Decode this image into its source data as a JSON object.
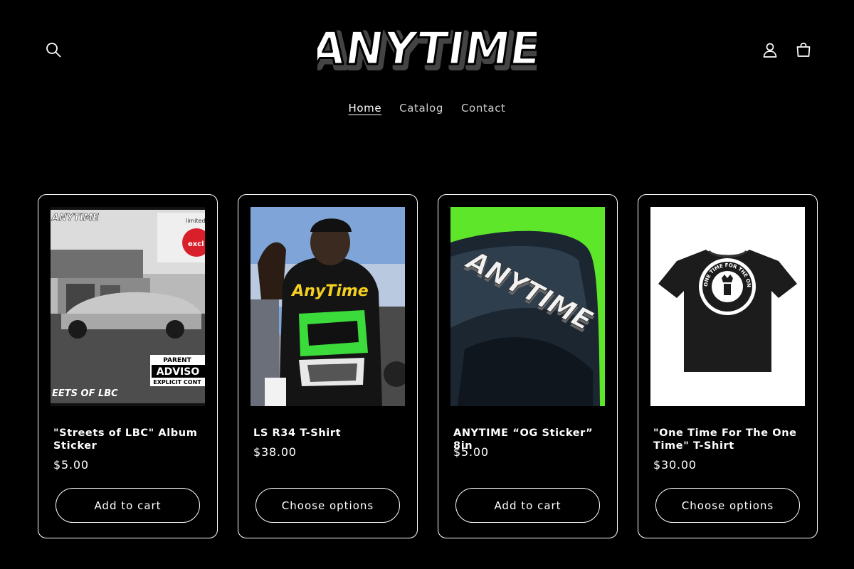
{
  "header": {
    "logo_text": "ANYTIME",
    "search_icon": "search-icon",
    "account_icon": "account-icon",
    "cart_icon": "cart-icon"
  },
  "nav": {
    "items": [
      {
        "label": "Home",
        "active": true
      },
      {
        "label": "Catalog",
        "active": false
      },
      {
        "label": "Contact",
        "active": false
      }
    ]
  },
  "products": [
    {
      "title": "\"Streets of LBC\" Album Sticker",
      "price": "$5.00",
      "button": "Add to cart"
    },
    {
      "title": "LS R34 T-Shirt",
      "price": "$38.00",
      "button": "Choose options"
    },
    {
      "title": "ANYTIME “OG Sticker” 8in",
      "price": "$5.00",
      "button": "Add to cart"
    },
    {
      "title": "\"One Time For The One Time\" T-Shirt",
      "price": "$30.00",
      "button": "Choose options"
    }
  ],
  "product_images": {
    "album": {
      "brand_text": "ANYTIME",
      "tag_text": "limited",
      "badge_text": "excl",
      "advisory_top": "PARENT",
      "advisory_mid": "ADVISO",
      "advisory_bottom": "EXPLICIT CONT",
      "caption": "EETS OF LBC"
    },
    "shirt_back": {
      "print_text": "AnyTime"
    },
    "sticker": {
      "sticker_text": "ANYTIME"
    },
    "tee": {
      "ring_text": "ONE TIME FOR THE ONE TIME"
    }
  },
  "colors": {
    "background": "#000000",
    "text": "#ffffff",
    "accent_green": "#5ee62a"
  }
}
